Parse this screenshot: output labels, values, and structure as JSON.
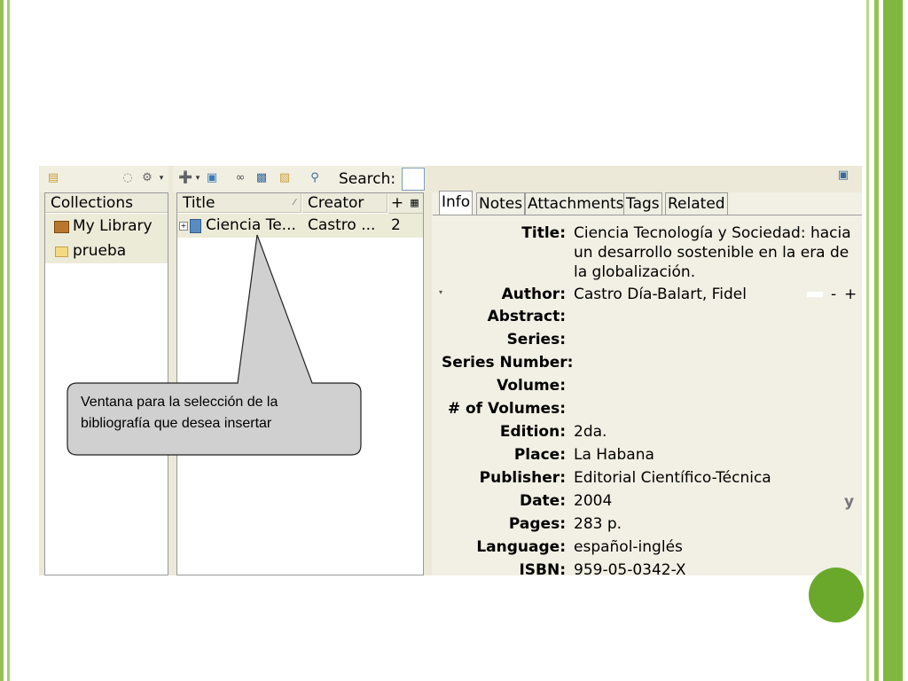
{
  "toolbar": {
    "search_label": "Search:",
    "search_value": ""
  },
  "collections": {
    "header": "Collections",
    "items": [
      {
        "label": "My Library",
        "icon": "library-icon"
      },
      {
        "label": "prueba",
        "icon": "folder-icon"
      }
    ]
  },
  "items": {
    "columns": {
      "title": "Title",
      "creator": "Creator",
      "add": "+"
    },
    "rows": [
      {
        "expander": "+",
        "title": "Ciencia Te...",
        "creator": "Castro ...",
        "count": "2"
      }
    ]
  },
  "tabs": [
    {
      "label": "Info",
      "active": true
    },
    {
      "label": "Notes",
      "active": false
    },
    {
      "label": "Attachments",
      "active": false
    },
    {
      "label": "Tags",
      "active": false
    },
    {
      "label": "Related",
      "active": false
    }
  ],
  "info": {
    "title_label": "Title:",
    "title_value": [
      "Ciencia Tecnología y Sociedad: hacia",
      "un desarrollo sostenible en la era de",
      "la globalización."
    ],
    "author_label": "Author:",
    "author_value": "Castro Día-Balart,  Fidel",
    "author_remove": "-",
    "author_add": "+",
    "fields": [
      {
        "label": "Abstract:",
        "value": ""
      },
      {
        "label": "Series:",
        "value": ""
      },
      {
        "label": "Series Number:",
        "value": ""
      },
      {
        "label": "Volume:",
        "value": ""
      },
      {
        "label": "# of Volumes:",
        "value": ""
      },
      {
        "label": "Edition:",
        "value": "2da."
      },
      {
        "label": "Place:",
        "value": "La Habana"
      },
      {
        "label": "Publisher:",
        "value": "Editorial Científico-Técnica"
      },
      {
        "label": "Date:",
        "value": "2004"
      },
      {
        "label": "Pages:",
        "value": "283 p."
      },
      {
        "label": "Language:",
        "value": "español-inglés"
      },
      {
        "label": "ISBN:",
        "value": "959-05-0342-X"
      }
    ],
    "date_hint": "y"
  },
  "callout": {
    "text_line1": "Ventana para la selección de la",
    "text_line2": "bibliografía que desea insertar"
  },
  "colors": {
    "slide_green": "#92c353",
    "accent_green": "#6aa82c",
    "callout_fill": "#d0d0d0"
  }
}
